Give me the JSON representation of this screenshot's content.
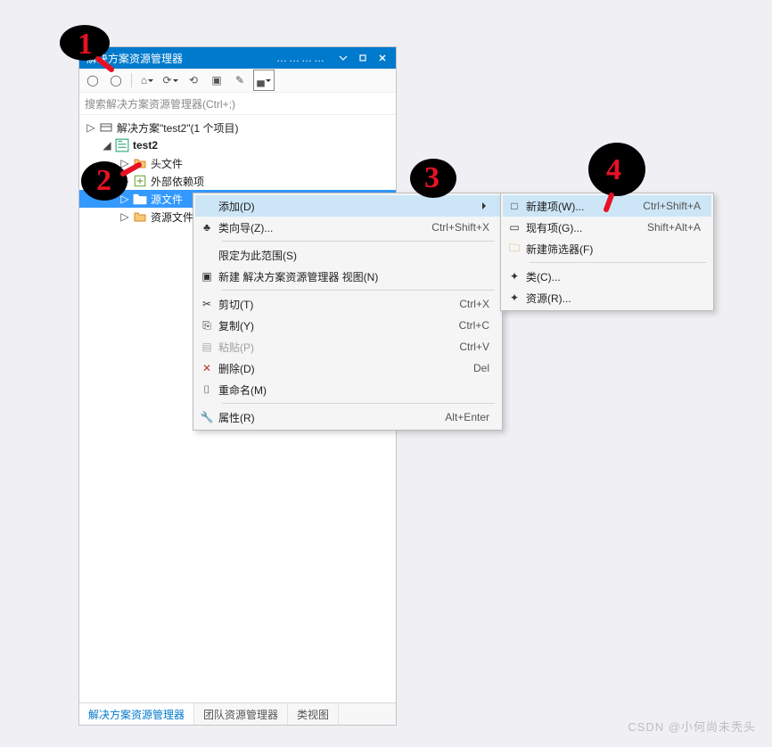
{
  "panel": {
    "title": "解决方案资源管理器",
    "search_placeholder": "搜索解决方案资源管理器(Ctrl+;)",
    "tree": {
      "solution": "解决方案\"test2\"(1 个项目)",
      "project": "test2",
      "folders": {
        "headers": "头文件",
        "external": "外部依赖项",
        "sources": "源文件",
        "resources": "资源文件"
      }
    },
    "tabs": {
      "solution_explorer": "解决方案资源管理器",
      "team_explorer": "团队资源管理器",
      "class_view": "类视图"
    }
  },
  "context_menu_1": {
    "items": {
      "add": "添加(D)",
      "class_wizard": "类向导(Z)...",
      "class_wizard_shortcut": "Ctrl+Shift+X",
      "scope": "限定为此范围(S)",
      "new_view": "新建 解决方案资源管理器 视图(N)",
      "cut": "剪切(T)",
      "cut_shortcut": "Ctrl+X",
      "copy": "复制(Y)",
      "copy_shortcut": "Ctrl+C",
      "paste": "粘贴(P)",
      "paste_shortcut": "Ctrl+V",
      "delete": "删除(D)",
      "delete_shortcut": "Del",
      "rename": "重命名(M)",
      "properties": "属性(R)",
      "properties_shortcut": "Alt+Enter"
    }
  },
  "context_menu_2": {
    "items": {
      "new_item": "新建项(W)...",
      "new_item_shortcut": "Ctrl+Shift+A",
      "existing_item": "现有项(G)...",
      "existing_item_shortcut": "Shift+Alt+A",
      "new_filter": "新建筛选器(F)",
      "class": "类(C)...",
      "resource": "资源(R)..."
    }
  },
  "watermark": "CSDN @小何尚未秃头"
}
